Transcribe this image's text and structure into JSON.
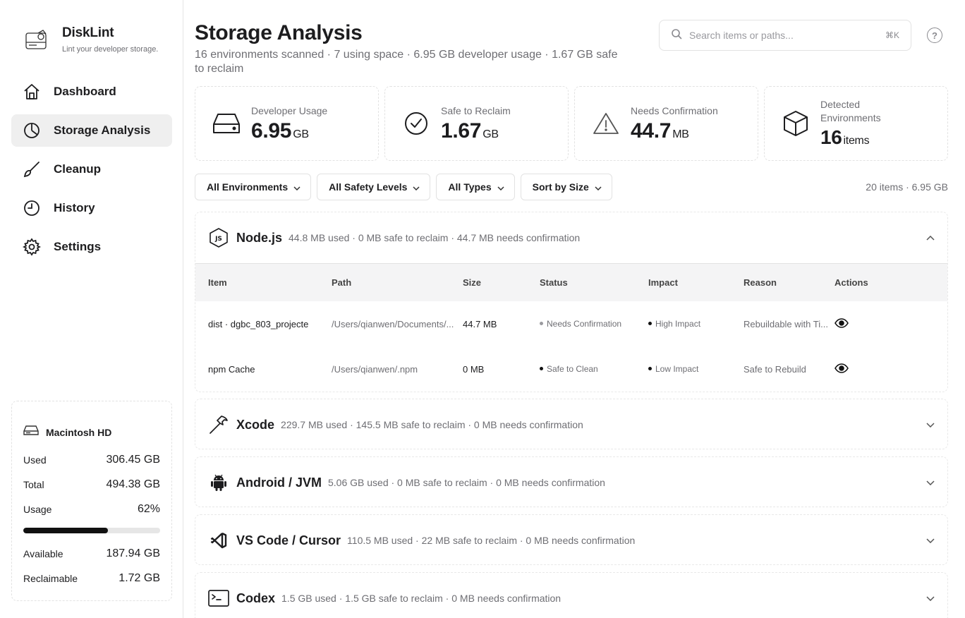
{
  "app": {
    "name": "DiskLint",
    "tagline": "Lint your developer storage."
  },
  "nav": [
    {
      "label": "Dashboard",
      "icon": "home-icon"
    },
    {
      "label": "Storage Analysis",
      "icon": "pie-chart-icon",
      "active": true
    },
    {
      "label": "Cleanup",
      "icon": "brush-icon"
    },
    {
      "label": "History",
      "icon": "clock-icon"
    },
    {
      "label": "Settings",
      "icon": "gear-icon"
    }
  ],
  "disk": {
    "name": "Macintosh HD",
    "used_label": "Used",
    "used": "306.45 GB",
    "total_label": "Total",
    "total": "494.38 GB",
    "usage_label": "Usage",
    "usage": "62%",
    "usage_fraction": 0.62,
    "available_label": "Available",
    "available": "187.94 GB",
    "reclaimable_label": "Reclaimable",
    "reclaimable": "1.72 GB"
  },
  "header": {
    "title": "Storage Analysis",
    "subtitle": "16 environments scanned · 7 using space · 6.95 GB developer usage · 1.67 GB safe to reclaim",
    "search_placeholder": "Search items or paths...",
    "search_shortcut": "⌘K",
    "help": "?"
  },
  "stats": [
    {
      "label": "Developer Usage",
      "value": "6.95",
      "unit": "GB",
      "icon": "drive-icon"
    },
    {
      "label": "Safe to Reclaim",
      "value": "1.67",
      "unit": "GB",
      "icon": "check-circle-icon"
    },
    {
      "label": "Needs Confirmation",
      "value": "44.7",
      "unit": "MB",
      "icon": "warning-icon"
    },
    {
      "label": "Detected Environments",
      "value": "16",
      "unit": "items",
      "icon": "cube-icon"
    }
  ],
  "filters": {
    "environments": "All Environments",
    "safety": "All Safety Levels",
    "types": "All Types",
    "sort": "Sort by Size",
    "summary": "20 items · 6.95 GB"
  },
  "table_headers": {
    "item": "Item",
    "path": "Path",
    "size": "Size",
    "status": "Status",
    "impact": "Impact",
    "reason": "Reason",
    "actions": "Actions"
  },
  "environments": [
    {
      "name": "Node.js",
      "meta": "44.8 MB used · 0 MB safe to reclaim · 44.7 MB needs confirmation",
      "expanded": true,
      "rows": [
        {
          "item": "dist · dgbc_803_projecte",
          "path": "/Users/qianwen/Documents/...",
          "size": "44.7 MB",
          "status": "Needs Confirmation",
          "status_color": "#9a9a9f",
          "impact": "High Impact",
          "impact_color": "#111111",
          "reason": "Rebuildable with Ti..."
        },
        {
          "item": "npm Cache",
          "path": "/Users/qianwen/.npm",
          "size": "0 MB",
          "status": "Safe to Clean",
          "status_color": "#111111",
          "impact": "Low Impact",
          "impact_color": "#111111",
          "reason": "Safe to Rebuild"
        }
      ]
    },
    {
      "name": "Xcode",
      "meta": "229.7 MB used · 145.5 MB safe to reclaim · 0 MB needs confirmation"
    },
    {
      "name": "Android / JVM",
      "meta": "5.06 GB used · 0 MB safe to reclaim · 0 MB needs confirmation"
    },
    {
      "name": "VS Code / Cursor",
      "meta": "110.5 MB used · 22 MB safe to reclaim · 0 MB needs confirmation"
    },
    {
      "name": "Codex",
      "meta": "1.5 GB used · 1.5 GB safe to reclaim · 0 MB needs confirmation"
    }
  ]
}
